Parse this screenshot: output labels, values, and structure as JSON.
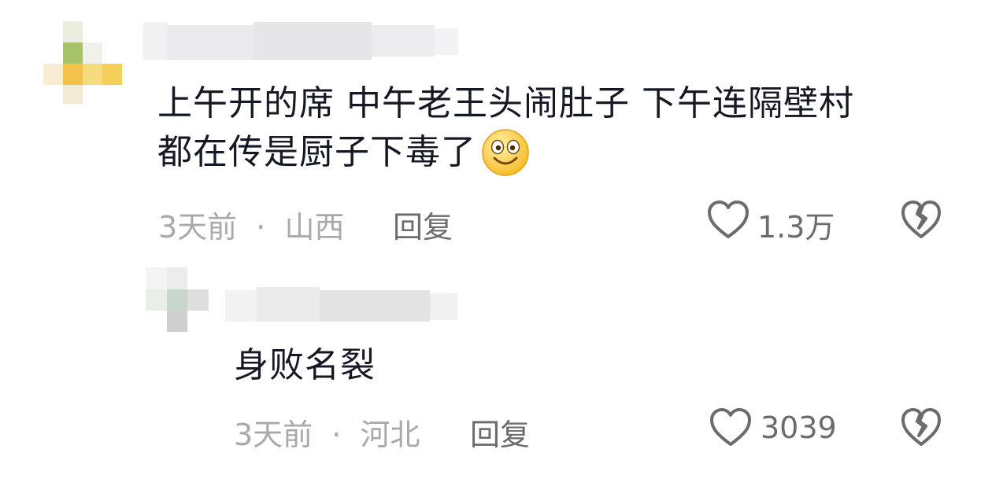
{
  "comments": [
    {
      "text_line1": "上午开的席 中午老王头闹肚子 下午连隔壁村",
      "text_line2": "都在传是厨子下毒了",
      "emoji": "smile-emoji",
      "time": "3天前",
      "separator": "·",
      "location": "山西",
      "reply_label": "回复",
      "likes": "1.3万"
    },
    {
      "text_line1": "身败名裂",
      "time": "3天前",
      "separator": "·",
      "location": "河北",
      "reply_label": "回复",
      "likes": "3039"
    }
  ],
  "icons": {
    "like": "heart-outline-icon",
    "dislike": "broken-heart-icon"
  },
  "colors": {
    "text": "#161823",
    "meta": "#a9a9ad",
    "action": "#6b6b70",
    "emoji_yellow": "#ffd33d"
  }
}
